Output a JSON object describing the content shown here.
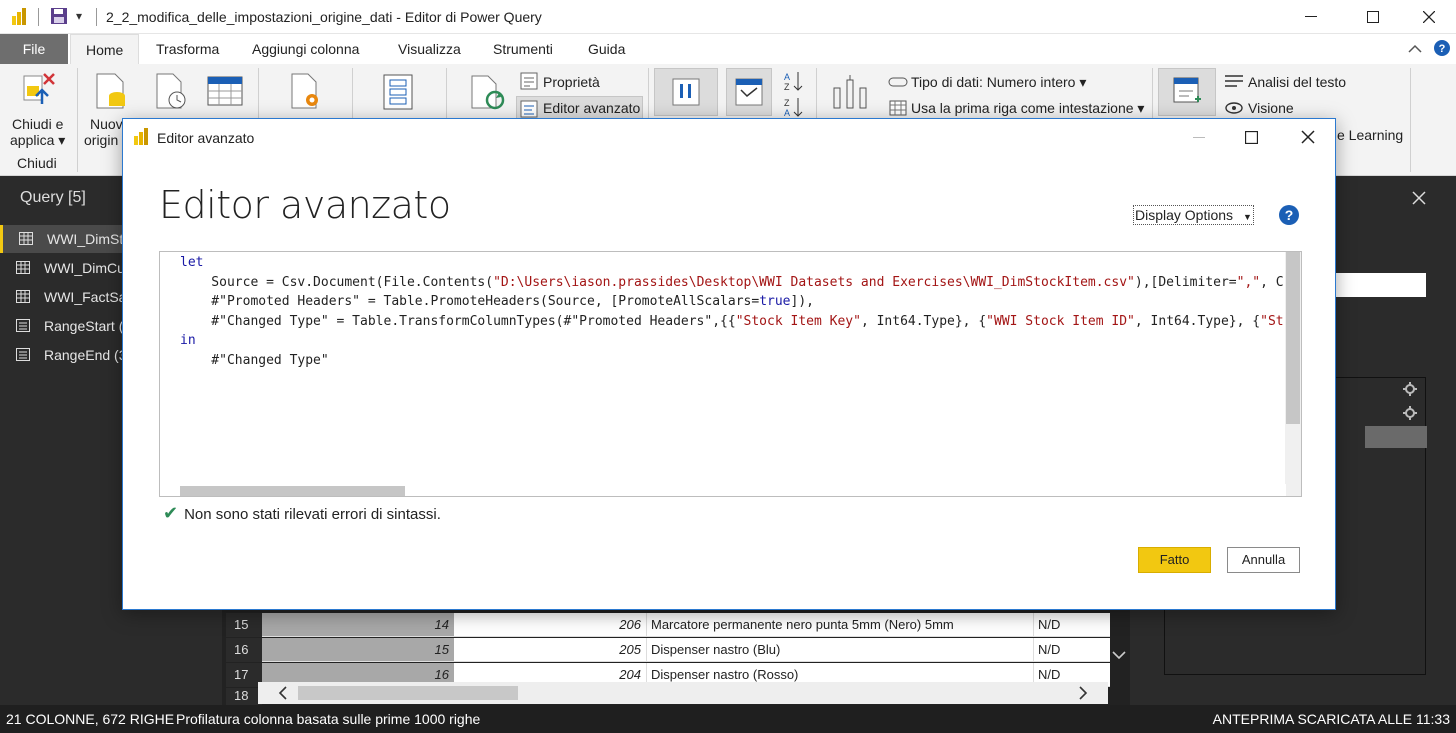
{
  "window": {
    "title": "2_2_modifica_delle_impostazioni_origine_dati - Editor di Power Query",
    "qa_dropdown": "▾"
  },
  "tabs": [
    "File",
    "Home",
    "Trasforma",
    "Aggiungi colonna",
    "Visualizza",
    "Strumenti",
    "Guida"
  ],
  "ribbon": {
    "close_apply_line1": "Chiudi e",
    "close_apply_line2": "applica ▾",
    "close_group": "Chiudi",
    "new_source_line1": "Nuov",
    "new_source_line2": "origin",
    "properties": "Proprietà",
    "advanced_editor": "Editor avanzato",
    "data_type": "Tipo di dati: Numero intero ▾",
    "first_row_header": "Usa la prima riga come intestazione ▾",
    "text_analytics": "Analisi del testo",
    "vision": "Visione",
    "azure_ml": "e Learning"
  },
  "queries": {
    "title": "Query [5]",
    "items": [
      {
        "label": "WWI_DimSt",
        "type": "table"
      },
      {
        "label": "WWI_DimCu",
        "type": "table"
      },
      {
        "label": "WWI_FactSa",
        "type": "table"
      },
      {
        "label": "RangeStart (",
        "type": "param"
      },
      {
        "label": "RangeEnd (3",
        "type": "param"
      }
    ]
  },
  "grid": {
    "rows": [
      {
        "n": "15",
        "a": "14",
        "b": "206",
        "c": "Marcatore permanente nero punta 5mm (Nero) 5mm",
        "d": "N/D"
      },
      {
        "n": "16",
        "a": "15",
        "b": "205",
        "c": "Dispenser nastro (Blu)",
        "d": "N/D"
      },
      {
        "n": "17",
        "a": "16",
        "b": "204",
        "c": "Dispenser nastro (Rosso)",
        "d": "N/D"
      },
      {
        "n": "18",
        "a": "",
        "b": "",
        "c": "",
        "d": ""
      }
    ]
  },
  "status": {
    "left": "21 COLONNE, 672 RIGHE",
    "profile": "Profilatura colonna basata sulle prime 1000 righe",
    "right": "ANTEPRIMA SCARICATA ALLE 11:33"
  },
  "dialog": {
    "title": "Editor avanzato",
    "heading": "Editor avanzato",
    "display_options": "Display Options",
    "help": "?",
    "code": {
      "line1_kw": "let",
      "line2_pre": "    Source = Csv.Document(File.Contents(",
      "line2_str": "\"D:\\Users\\iason.prassides\\Desktop\\WWI Datasets and Exercises\\WWI_DimStockItem.csv\"",
      "line2_post": "),[Delimiter=",
      "line2_str2": "\",\"",
      "line2_tail": ", C",
      "line3_pre": "    #\"Promoted Headers\" = Table.PromoteHeaders(Source, [PromoteAllScalars=",
      "line3_kw": "true",
      "line3_post": "]),",
      "line4_pre": "    #\"Changed Type\" = Table.TransformColumnTypes(#\"Promoted Headers\",{{",
      "line4_str1": "\"Stock Item Key\"",
      "line4_mid1": ", Int64.Type}, {",
      "line4_str2": "\"WWI Stock Item ID\"",
      "line4_mid2": ", Int64.Type}, {",
      "line4_str3": "\"St",
      "line5_kw": "in",
      "line6": "    #\"Changed Type\""
    },
    "syntax_status": "Non sono stati rilevati errori di sintassi.",
    "ok_label": "Fatto",
    "cancel_label": "Annulla"
  },
  "colors": {
    "accent": "#f2c811",
    "dark_bg": "#2b2b2b",
    "keyword": "#1a1aa6",
    "string": "#a31515"
  }
}
